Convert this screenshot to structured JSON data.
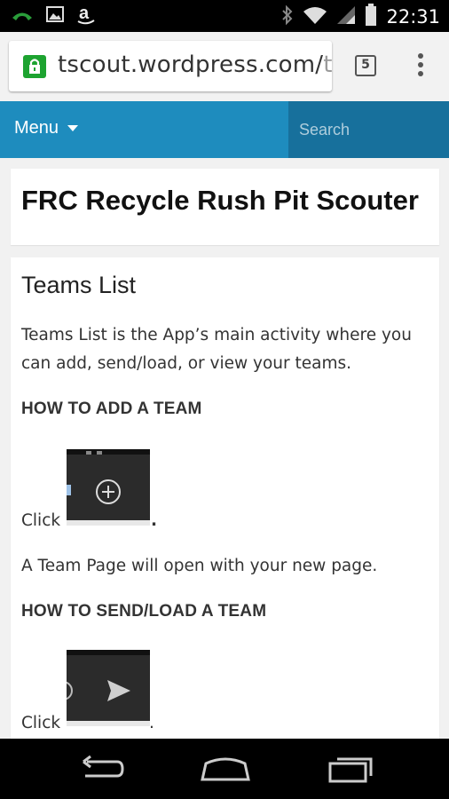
{
  "status_bar": {
    "time": "22:31",
    "icons": [
      "phone-icon",
      "image-icon",
      "amazon-icon",
      "bluetooth-icon",
      "wifi-icon",
      "signal-icon",
      "battery-icon"
    ]
  },
  "browser": {
    "url_main": "tscout.wordpress.com/",
    "url_fade": "t",
    "tab_count": "5"
  },
  "site_nav": {
    "menu_label": "Menu",
    "search_placeholder": "Search",
    "accent_color": "#1e8cbe"
  },
  "site": {
    "title": "FRC Recycle Rush Pit Scouter"
  },
  "article": {
    "title": "Teams List",
    "intro_line1": "Teams List is the App’s main activity where you",
    "intro_line2": "can add, send/load, or view your teams.",
    "heading_add": "HOW TO ADD A TEAM",
    "click_label_1": "Click",
    "after_add": "A Team Page will open with your new page.",
    "heading_send": "HOW TO SEND/LOAD A TEAM",
    "click_label_2": "Click"
  }
}
